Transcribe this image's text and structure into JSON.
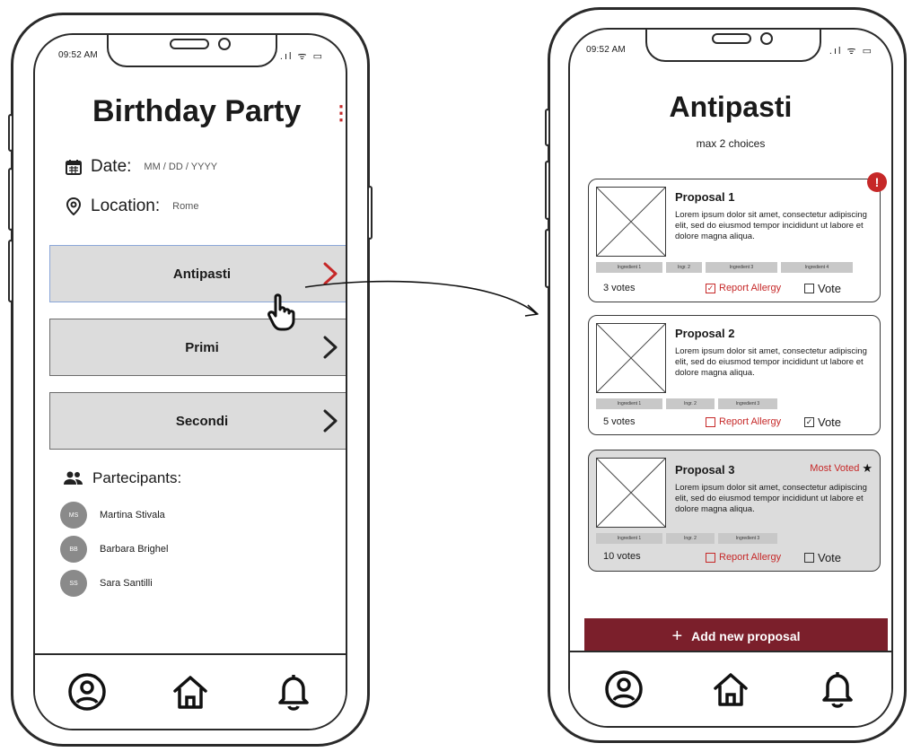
{
  "left_phone": {
    "status": {
      "time": "09:52 AM",
      "icons": ".ıl ᯤ ▭"
    },
    "title": "Birthday Party",
    "menu_icon": "⋮",
    "date": {
      "label": "Date:",
      "value": "MM / DD / YYYY"
    },
    "location": {
      "label": "Location:",
      "value": "Rome"
    },
    "categories": [
      {
        "label": "Antipasti",
        "active": true
      },
      {
        "label": "Primi",
        "active": false
      },
      {
        "label": "Secondi",
        "active": false
      }
    ],
    "participants_label": "Partecipants:",
    "participants": [
      {
        "initials": "MS",
        "name": "Martina Stivala"
      },
      {
        "initials": "BB",
        "name": "Barbara Brighel"
      },
      {
        "initials": "SS",
        "name": "Sara Santilli"
      }
    ]
  },
  "right_phone": {
    "status": {
      "time": "09:52 AM",
      "icons": ".ıl ᯤ ▭"
    },
    "title": "Antipasti",
    "subtitle": "max 2 choices",
    "proposals": [
      {
        "title": "Proposal 1",
        "description": "Lorem ipsum dolor sit amet, consectetur adipiscing elit, sed do eiusmod tempor incididunt ut labore et dolore magna aliqua.",
        "tags": [
          "Ingredient 1",
          "Ingr. 2",
          "Ingredient 3",
          "Ingredient 4"
        ],
        "votes": "3 votes",
        "report_label": "Report Allergy",
        "report_checked": true,
        "vote_label": "Vote",
        "vote_checked": false,
        "alert": "!"
      },
      {
        "title": "Proposal 2",
        "description": "Lorem ipsum dolor sit amet, consectetur adipiscing elit, sed do eiusmod tempor incididunt ut labore et dolore magna aliqua.",
        "tags": [
          "Ingredient 1",
          "Ingr. 2",
          "Ingredient 3"
        ],
        "votes": "5 votes",
        "report_label": "Report Allergy",
        "report_checked": false,
        "vote_label": "Vote",
        "vote_checked": true
      },
      {
        "title": "Proposal 3",
        "badge": "Most Voted",
        "description": "Lorem ipsum dolor sit amet, consectetur adipiscing elit, sed do eiusmod tempor incididunt ut labore et dolore magna aliqua.",
        "tags": [
          "Ingredient 1",
          "Ingr. 2",
          "Ingredient 3"
        ],
        "votes": "10 votes",
        "report_label": "Report Allergy",
        "report_checked": false,
        "vote_label": "Vote",
        "vote_checked": false
      }
    ],
    "add_button": {
      "icon": "+",
      "label": "Add new proposal"
    }
  },
  "colors": {
    "accent": "#7b1f2b",
    "alert": "#c62828",
    "button_gray": "#dcdcdc"
  }
}
